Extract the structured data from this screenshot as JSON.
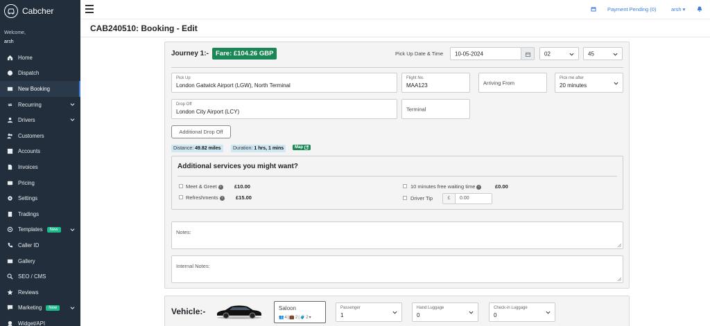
{
  "brand": {
    "name": "Cabcher"
  },
  "welcome": {
    "label": "Welcome,",
    "user": "arsh"
  },
  "sidebar": {
    "items": [
      {
        "label": "Home",
        "icon": "home-icon"
      },
      {
        "label": "Dispatch",
        "icon": "globe-icon"
      },
      {
        "label": "New Booking",
        "icon": "booking-icon",
        "active": true
      },
      {
        "label": "Recurring",
        "icon": "repeat-icon",
        "chevron": true
      },
      {
        "label": "Drivers",
        "icon": "user-icon",
        "chevron": true
      },
      {
        "label": "Customers",
        "icon": "users-icon"
      },
      {
        "label": "Accounts",
        "icon": "accounts-icon"
      },
      {
        "label": "Invoices",
        "icon": "file-icon"
      },
      {
        "label": "Pricing",
        "icon": "pricing-icon"
      },
      {
        "label": "Settings",
        "icon": "gear-icon"
      },
      {
        "label": "Tradings",
        "icon": "building-icon"
      },
      {
        "label": "Templates",
        "icon": "at-icon",
        "badge": "New",
        "chevron": true
      },
      {
        "label": "Caller ID",
        "icon": "phone-icon"
      },
      {
        "label": "Gallery",
        "icon": "image-icon"
      },
      {
        "label": "SEO / CMS",
        "icon": "search-icon"
      },
      {
        "label": "Reviews",
        "icon": "star-icon"
      },
      {
        "label": "Marketing",
        "icon": "chat-icon",
        "badge": "New",
        "chevron": true
      },
      {
        "label": "Widget/API",
        "icon": "widget-icon"
      }
    ]
  },
  "topbar": {
    "payment_pending": "Payment Pending (0)",
    "user": "arsh"
  },
  "page": {
    "title": "CAB240510: Booking - Edit"
  },
  "journey": {
    "title": "Journey 1:-",
    "fare": "Fare: £104.26 GBP",
    "pickup_datetime_label": "Pick Up Date & Time",
    "date": "10-05-2024",
    "hour": "02",
    "minute": "45",
    "pickup_label": "Pick Up",
    "pickup_value": "London Gatwick Airport (LGW), North Terminal",
    "flight_label": "Flight No.",
    "flight_value": "MAA123",
    "arriving_from_placeholder": "Arriving From",
    "pick_me_after_label": "Pick me after",
    "pick_me_after_value": "20 minutes",
    "dropoff_label": "Drop Off",
    "dropoff_value": "London City Airport (LCY)",
    "terminal_placeholder": "Terminal",
    "additional_dropoff": "Additional Drop Off",
    "distance_label": "Distance:",
    "distance_value": "49.82 miles",
    "duration_label": "Duration:",
    "duration_value": "1 hrs, 1 mins",
    "map_label": "Map"
  },
  "services": {
    "title": "Additional services you might want?",
    "meet_greet": {
      "label": "Meet & Greet",
      "price": "£10.00"
    },
    "refreshments": {
      "label": "Refreshments",
      "price": "£15.00"
    },
    "waiting": {
      "label": "10 minutes free waiting time",
      "price": "£0.00"
    },
    "driver_tip": {
      "label": "Driver Tip",
      "currency": "£",
      "value": "0.00"
    }
  },
  "notes": {
    "notes_label": "Notes:",
    "internal_label": "Internal Notes:"
  },
  "vehicle": {
    "title": "Vehicle:-",
    "type": "Saloon",
    "passengers_icon_count": "4",
    "hand_icon_count": "2",
    "checkin_icon_count": "2",
    "passenger_label": "Passenger",
    "passenger_value": "1",
    "hand_luggage_label": "Hand Luggage",
    "hand_luggage_value": "0",
    "checkin_luggage_label": "Check-in Luggage",
    "checkin_luggage_value": "0"
  },
  "colors": {
    "sidebar": "#222e3c",
    "accent": "#3b7ddd",
    "success": "#1a8754"
  }
}
